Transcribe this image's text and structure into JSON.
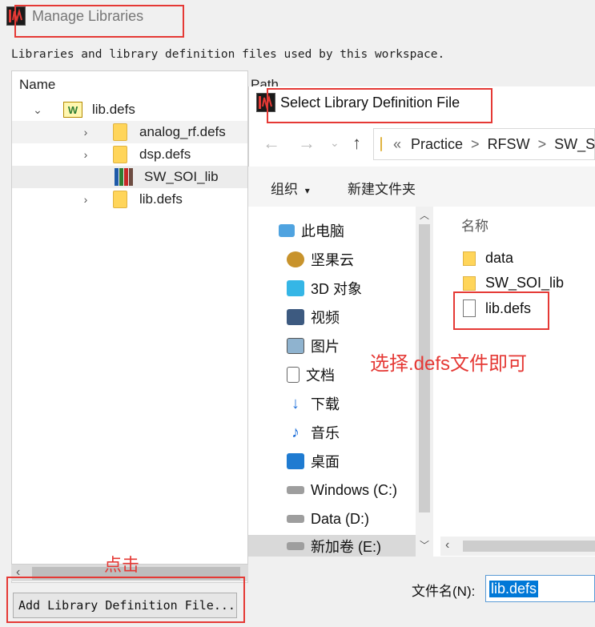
{
  "manage": {
    "title": "Manage Libraries",
    "description": "Libraries and library definition files used by this workspace.",
    "columns": {
      "name": "Name",
      "path": "Path"
    },
    "tree": [
      {
        "label": "lib.defs",
        "type": "workspace"
      },
      {
        "label": "analog_rf.defs",
        "type": "folder"
      },
      {
        "label": "dsp.defs",
        "type": "folder"
      },
      {
        "label": "SW_SOI_lib",
        "type": "library"
      },
      {
        "label": "lib.defs",
        "type": "folder"
      }
    ],
    "add_button": "Add Library Definition File...",
    "annotation_click": "点击"
  },
  "dialog": {
    "title": "Select Library Definition File",
    "breadcrumb": [
      "«",
      "Practice",
      ">",
      "RFSW",
      ">",
      "SW_S"
    ],
    "toolbar": {
      "organize": "组织",
      "organize_caret": "▾",
      "new_folder": "新建文件夹"
    },
    "nav_items": [
      {
        "label": "此电脑",
        "icon": "pc-icon"
      },
      {
        "label": "坚果云",
        "icon": "nutstore-icon"
      },
      {
        "label": "3D 对象",
        "icon": "3d-objects-icon"
      },
      {
        "label": "视频",
        "icon": "video-icon"
      },
      {
        "label": "图片",
        "icon": "picture-icon"
      },
      {
        "label": "文档",
        "icon": "document-icon"
      },
      {
        "label": "下载",
        "icon": "download-icon"
      },
      {
        "label": "音乐",
        "icon": "music-icon"
      },
      {
        "label": "桌面",
        "icon": "desktop-icon"
      },
      {
        "label": "Windows (C:)",
        "icon": "drive-c-icon"
      },
      {
        "label": "Data (D:)",
        "icon": "drive-d-icon"
      },
      {
        "label": "新加卷 (E:)",
        "icon": "drive-e-icon"
      }
    ],
    "file_column": "名称",
    "files": [
      {
        "label": "data",
        "type": "folder"
      },
      {
        "label": "SW_SOI_lib",
        "type": "folder"
      },
      {
        "label": "lib.defs",
        "type": "file"
      }
    ],
    "annotation_choose": "选择.defs文件即可",
    "filename_label": "文件名(N):",
    "filename_value": "lib.defs"
  }
}
